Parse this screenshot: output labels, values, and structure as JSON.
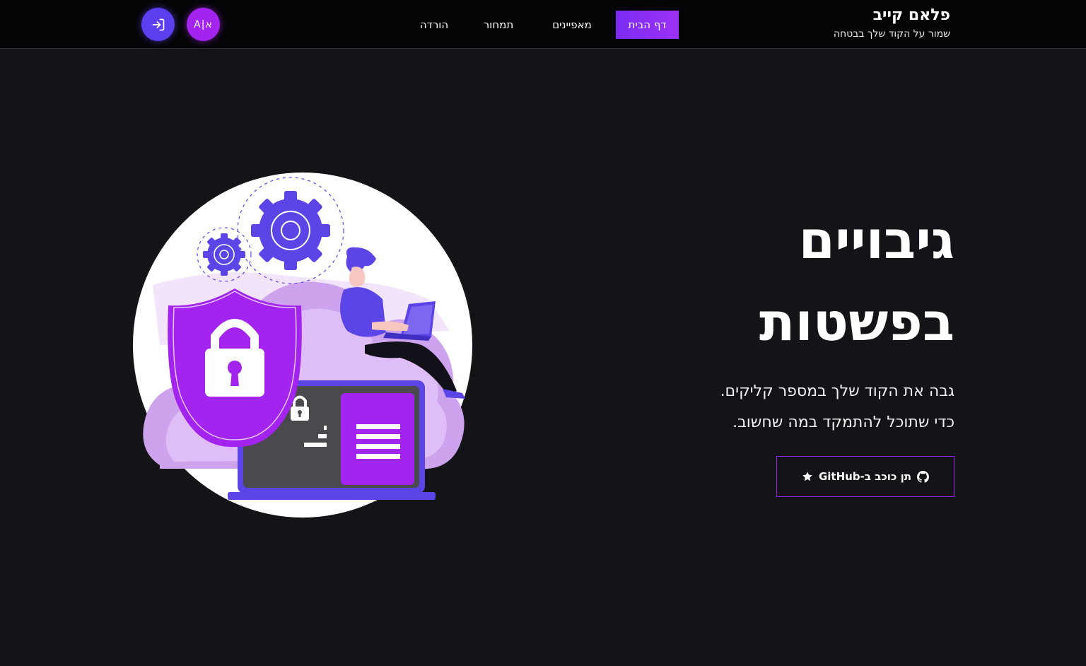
{
  "brand": {
    "name": "פלאם קייב",
    "tagline": "שמור על הקוד שלך בבטחה"
  },
  "nav": {
    "home": "דף הבית",
    "features": "מאפיינים",
    "pricing": "תמחור",
    "download": "הורדה"
  },
  "lang_toggle": "A|א",
  "hero": {
    "title_line1": "גיבויים",
    "title_line2": "בפשטות",
    "sub_line1": "גבה את הקוד שלך במספר קליקים.",
    "sub_line2": "כדי שתוכל להתמקד במה שחשוב.",
    "cta": "תן כוכב ב-GitHub"
  },
  "icons": [
    "sign-in-icon",
    "star-icon",
    "github-icon"
  ],
  "colors": {
    "background": "#141318",
    "topbar": "#050507",
    "accent_purple": "#9b32f3",
    "accent_indigo": "#5e3ff0"
  }
}
